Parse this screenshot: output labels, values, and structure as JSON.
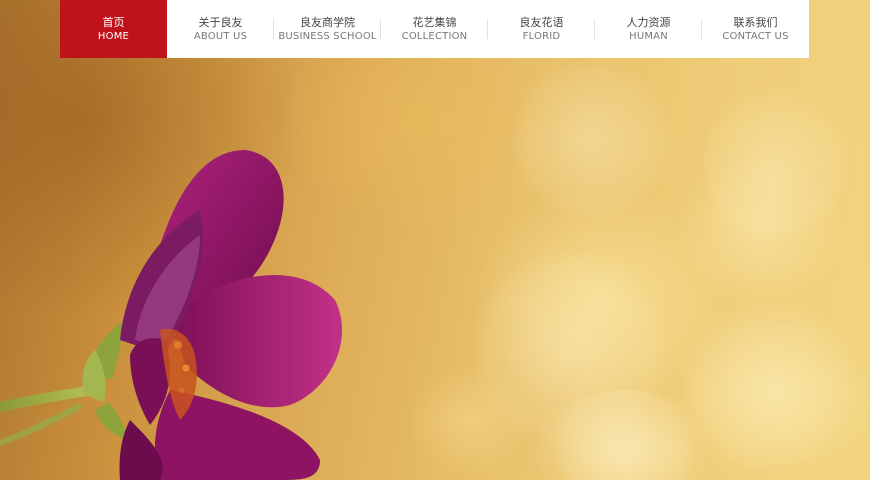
{
  "nav": {
    "items": [
      {
        "zh": "首页",
        "en": "HOME",
        "active": true
      },
      {
        "zh": "关于良友",
        "en": "ABOUT US",
        "active": false
      },
      {
        "zh": "良友商学院",
        "en": "BUSINESS SCHOOL",
        "active": false
      },
      {
        "zh": "花艺集锦",
        "en": "COLLECTION",
        "active": false
      },
      {
        "zh": "良友花语",
        "en": "FLORID",
        "active": false
      },
      {
        "zh": "人力资源",
        "en": "HUMAN",
        "active": false
      },
      {
        "zh": "联系我们",
        "en": "CONTACT US",
        "active": false
      }
    ]
  },
  "colors": {
    "accent": "#c0121a",
    "nav_bg": "#ffffff",
    "hero_gold": "#e8c06a",
    "flower_magenta": "#8a1060"
  },
  "hero": {
    "image": "magenta-cosmos-flower-on-golden-bokeh"
  }
}
